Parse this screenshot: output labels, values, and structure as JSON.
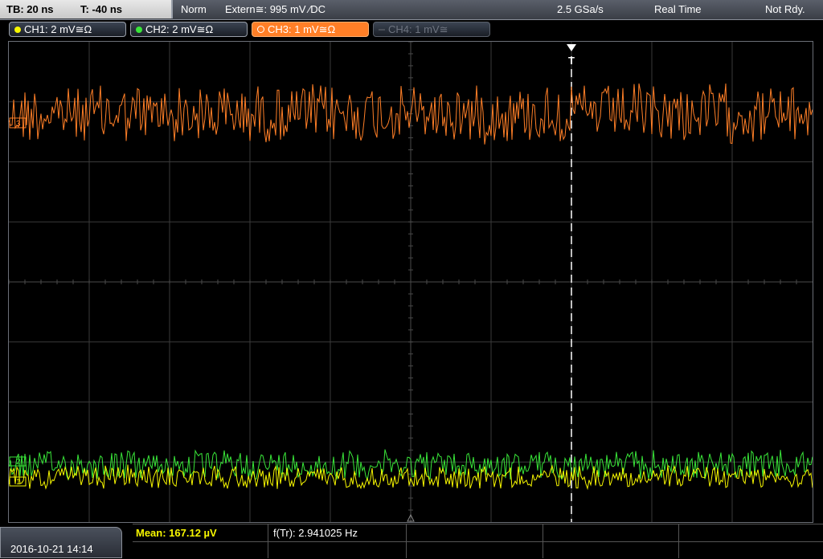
{
  "status_bar": {
    "timebase": "TB: 20 ns",
    "trigger_time": "T: -40 ns",
    "trigger_mode": "Norm",
    "trigger_source": "Extern≅: 995 mV ∕DC",
    "sample_rate": "2.5 GSa/s",
    "acq_mode": "Real Time",
    "state": "Not Rdy."
  },
  "channels": [
    {
      "label": "CH1: 2 mV≅Ω",
      "color": "#f7f700",
      "state": "on"
    },
    {
      "label": "CH2: 2 mV≅Ω",
      "color": "#39e639",
      "state": "on"
    },
    {
      "label": "CH3: 1 mV≅Ω",
      "color": "#ff7f27",
      "state": "active"
    },
    {
      "label": "CH4: 1 mV≅",
      "color": "#6e7480",
      "state": "off"
    }
  ],
  "markers": {
    "trigger": "T",
    "ch1_level": "1",
    "ch2_level": "2",
    "ch3_level": "3"
  },
  "footer": {
    "datetime": "2016-10-21 14:14",
    "measurements": [
      {
        "label": "Mean: 167.12 µV",
        "color": "#f7f700"
      },
      {
        "label": "f(Tr): 2.941025 Hz",
        "color": "#ffffff"
      }
    ]
  },
  "traces": {
    "ch3": {
      "color": "#ff7f27",
      "center_div": -2.8,
      "amp_div": 0.5
    },
    "ch2": {
      "color": "#39e639",
      "center_div": 3.05,
      "amp_div": 0.25
    },
    "ch1": {
      "color": "#f7f700",
      "center_div": 3.25,
      "amp_div": 0.2
    }
  }
}
